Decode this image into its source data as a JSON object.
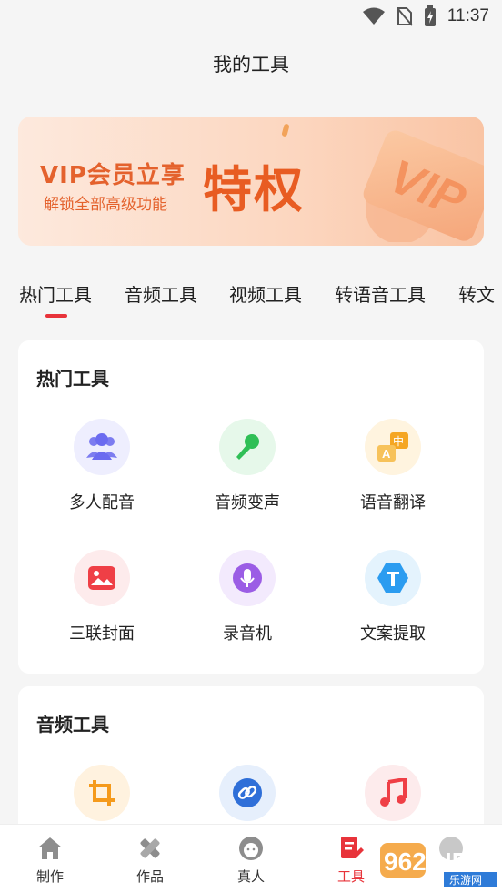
{
  "status_bar": {
    "time": "11:37"
  },
  "header": {
    "title": "我的工具"
  },
  "banner": {
    "line1": "VIP会员立享",
    "line2": "解锁全部高级功能",
    "highlight": "特权",
    "card_text": "VIP"
  },
  "tabs": [
    "热门工具",
    "音频工具",
    "视频工具",
    "转语音工具",
    "转文"
  ],
  "hot_section": {
    "title": "热门工具",
    "tools": [
      {
        "label": "多人配音",
        "icon": "group-icon"
      },
      {
        "label": "音频变声",
        "icon": "microphone-icon"
      },
      {
        "label": "语音翻译",
        "icon": "translate-icon"
      },
      {
        "label": "三联封面",
        "icon": "image-icon"
      },
      {
        "label": "录音机",
        "icon": "recorder-icon"
      },
      {
        "label": "文案提取",
        "icon": "text-extract-icon"
      }
    ]
  },
  "audio_section": {
    "title": "音频工具",
    "tools": [
      {
        "icon": "crop-icon"
      },
      {
        "icon": "link-icon"
      },
      {
        "icon": "music-icon"
      }
    ]
  },
  "bottom_nav": [
    {
      "label": "制作",
      "icon": "home-icon"
    },
    {
      "label": "作品",
      "icon": "pen-ruler-icon"
    },
    {
      "label": "真人",
      "icon": "person-icon"
    },
    {
      "label": "工具",
      "icon": "tools-icon",
      "active": true
    },
    {
      "label": "",
      "icon": "profile-icon"
    }
  ],
  "watermark": {
    "text": "962.NET",
    "sub": "乐游网"
  },
  "colors": {
    "accent": "#e8333a",
    "banner_text": "#e4622d"
  }
}
